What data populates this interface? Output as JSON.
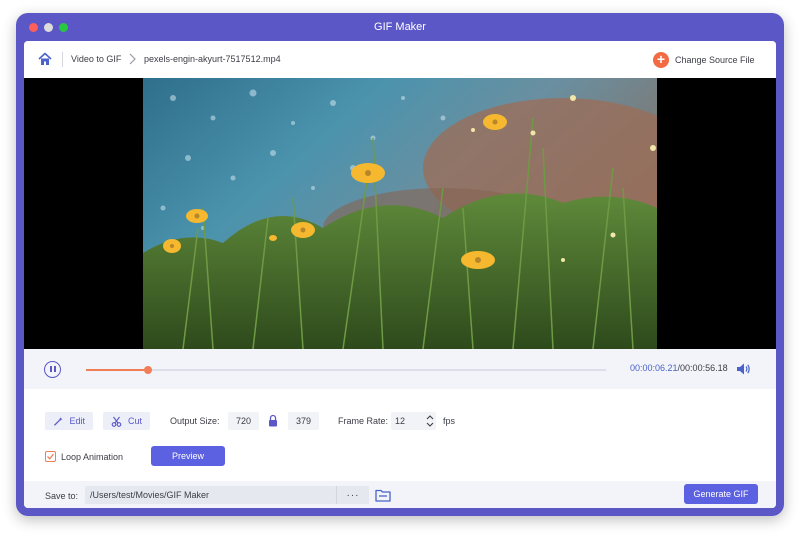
{
  "window": {
    "title": "GIF Maker"
  },
  "breadcrumb": {
    "section": "Video to GIF",
    "file": "pexels-engin-akyurt-7517512.mp4"
  },
  "header": {
    "change_source_label": "Change Source File"
  },
  "player": {
    "current_time": "00:00:06.21",
    "total_time": "/00:00:56.18",
    "progress_fraction": 0.12
  },
  "tools": {
    "edit_label": "Edit",
    "cut_label": "Cut"
  },
  "output": {
    "size_label": "Output Size:",
    "width": "720",
    "height": "379",
    "frame_rate_label": "Frame Rate:",
    "frame_rate": "12",
    "fps_unit": "fps"
  },
  "loop": {
    "label": "Loop Animation",
    "checked": true
  },
  "preview_label": "Preview",
  "save": {
    "label": "Save to:",
    "path": "/Users/test/Movies/GIF Maker",
    "browse_label": "···"
  },
  "generate_label": "Generate GIF",
  "colors": {
    "accent": "#5b57c6",
    "button": "#5b61e0",
    "orange": "#f07e57"
  }
}
